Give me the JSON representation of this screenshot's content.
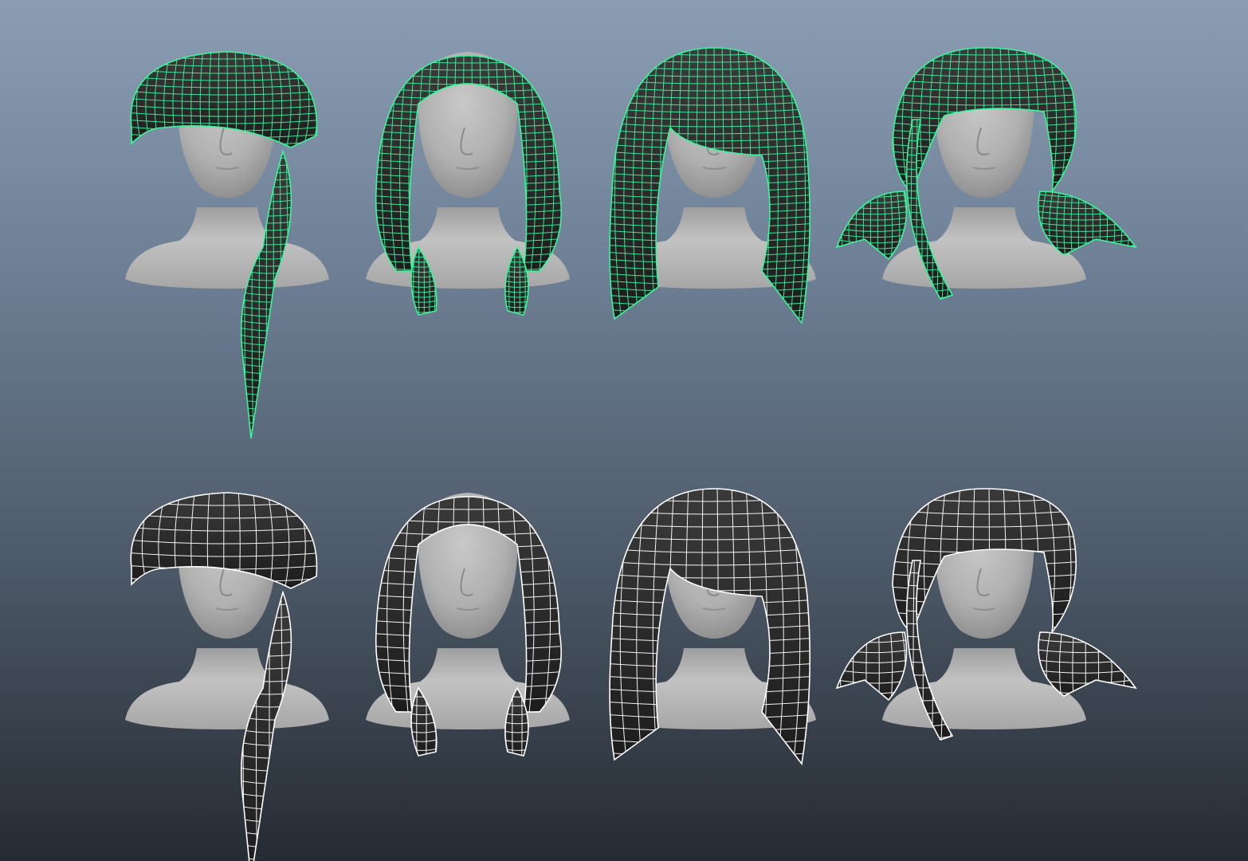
{
  "viewport": {
    "background_top": "#8b9db3",
    "background_bottom": "#252b33"
  },
  "colors": {
    "selected_wire": "#3df29a",
    "unselected_wire": "#ffffff",
    "hair_fill": "#262626",
    "hair_fill_light": "#3b3b3b",
    "skin": "#b4b4b4",
    "skin_shadow": "#8e8e8e"
  },
  "rows": [
    {
      "name": "selected-row",
      "state": "selected",
      "wire_color": "#3df29a"
    },
    {
      "name": "unselected-row",
      "state": "unselected",
      "wire_color": "#ffffff"
    }
  ],
  "hairstyles": [
    {
      "name": "bob-with-side-braid",
      "style": "bob"
    },
    {
      "name": "long-with-twin-braids",
      "style": "twin-braids"
    },
    {
      "name": "long-side-swept",
      "style": "long"
    },
    {
      "name": "twin-pigtails",
      "style": "pigtails"
    }
  ]
}
